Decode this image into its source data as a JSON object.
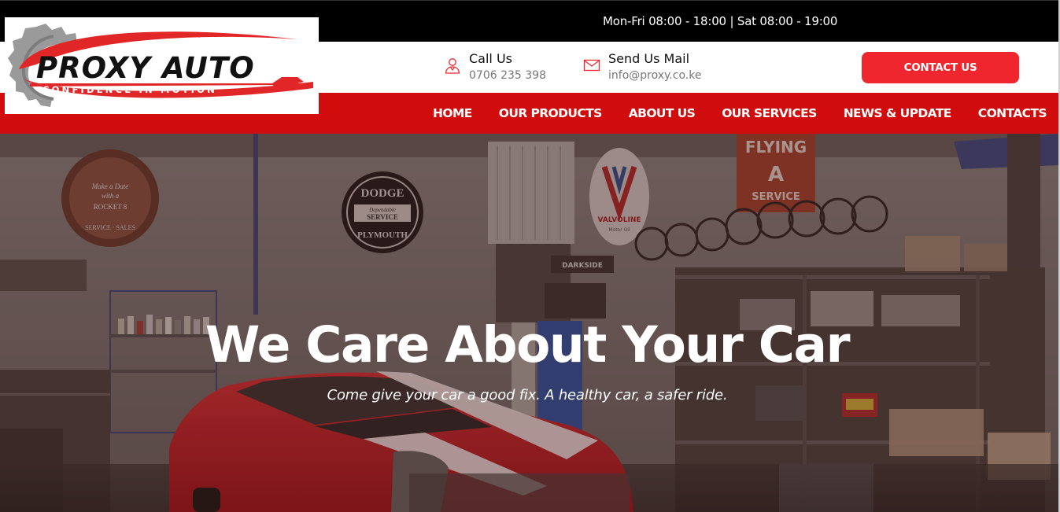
{
  "topbar": {
    "hours": "Mon-Fri 08:00 - 18:00 | Sat 08:00 - 19:00"
  },
  "logo": {
    "name": "PROXY AUTO",
    "tagline": "CONFIDENCE IN MOTION"
  },
  "header": {
    "call": {
      "title": "Call Us",
      "value": "0706 235 398",
      "icon": "user-phone-icon"
    },
    "mail": {
      "title": "Send Us Mail",
      "value": "info@proxy.co.ke",
      "icon": "envelope-icon"
    },
    "cta_label": "CONTACT US"
  },
  "nav": {
    "items": [
      {
        "label": "HOME"
      },
      {
        "label": "OUR PRODUCTS"
      },
      {
        "label": "ABOUT US"
      },
      {
        "label": "OUR SERVICES"
      },
      {
        "label": "NEWS & UPDATE"
      },
      {
        "label": "CONTACTS"
      }
    ]
  },
  "hero": {
    "title": "We Care About Your Car",
    "subtitle": "Come give your car a good fix. A healthy car, a safer ride.",
    "signs": {
      "oldsmobile": [
        "Make a Date",
        "with a",
        "ROCKET 8",
        "SERVICE · SALES"
      ],
      "dodge": [
        "DODGE",
        "Dependable",
        "SERVICE",
        "PLYMOUTH"
      ],
      "valvoline": [
        "VALVOLINE",
        "Motor Oil"
      ],
      "flying": [
        "FLYING",
        "SERVICE"
      ],
      "darkside": "DARKSIDE"
    }
  },
  "colors": {
    "brand_red": "#d10c0c",
    "cta_red": "#f0262e",
    "black": "#000000"
  }
}
